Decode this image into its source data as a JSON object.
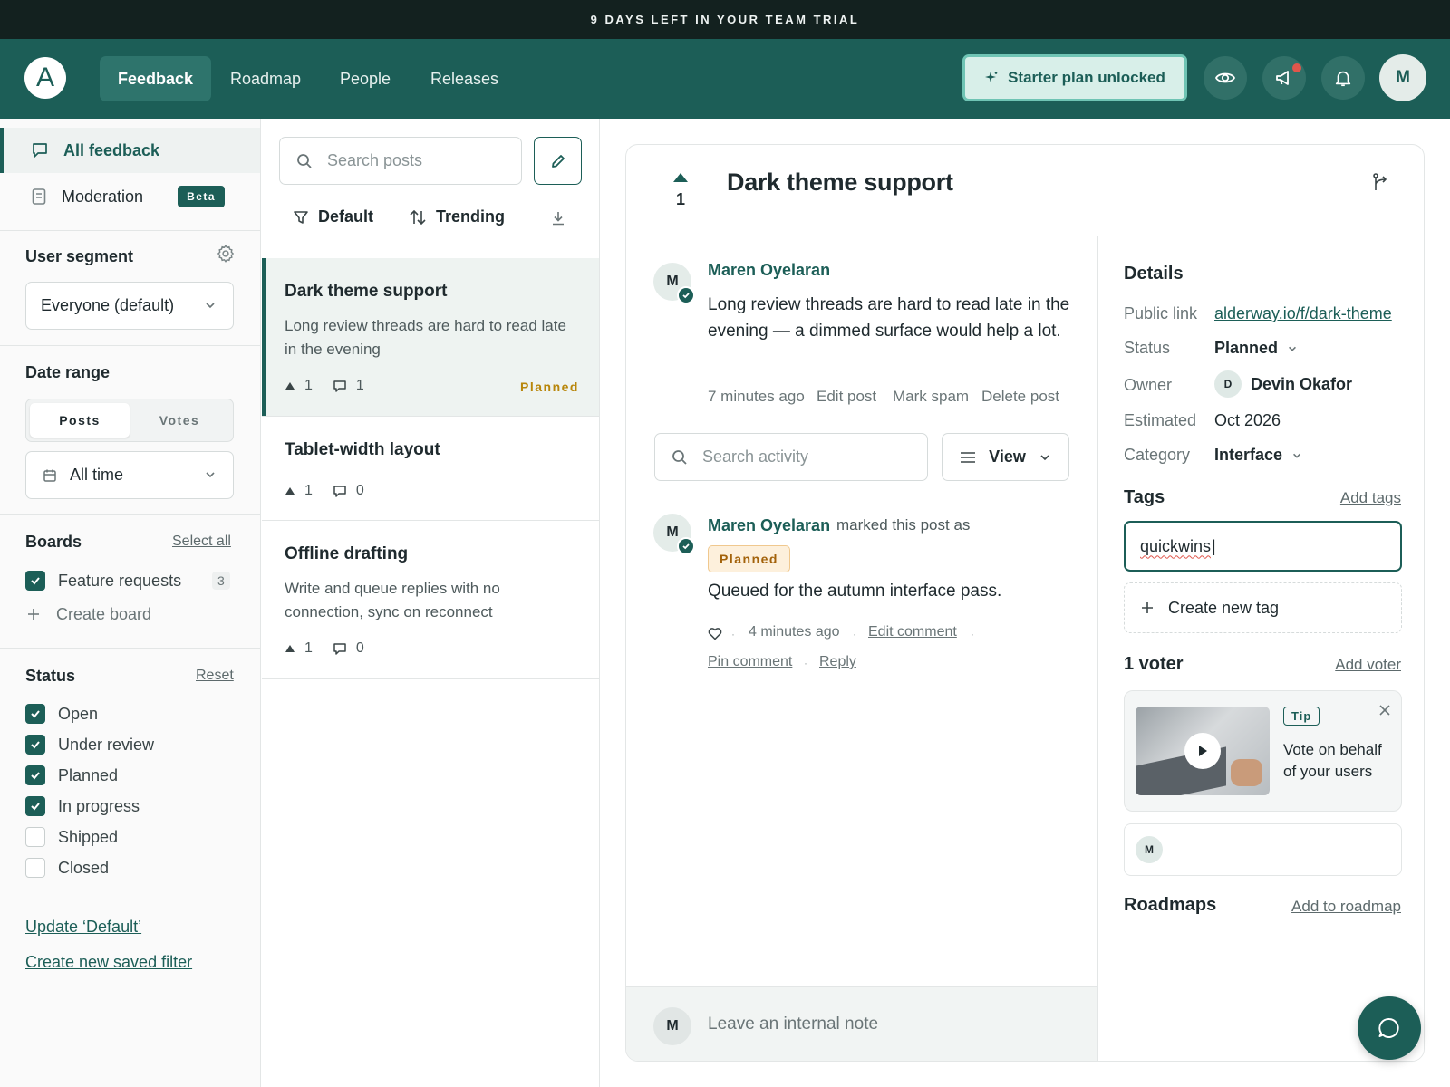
{
  "trial_banner": "9 DAYS LEFT IN YOUR TEAM TRIAL",
  "nav": {
    "logo": "A",
    "tabs": [
      "Feedback",
      "Roadmap",
      "People",
      "Releases"
    ],
    "active_tab": "Feedback",
    "starter_label": "Starter plan unlocked",
    "avatar_initial": "M"
  },
  "sidebar": {
    "items": [
      {
        "label": "All feedback",
        "icon": "chat-icon",
        "active": true
      },
      {
        "label": "Moderation",
        "icon": "document-icon",
        "badge": "Beta"
      }
    ],
    "user_segment": {
      "title": "User segment",
      "value": "Everyone (default)"
    },
    "date_range": {
      "title": "Date range",
      "segments": [
        "Posts",
        "Votes"
      ],
      "selected_segment": "Posts",
      "value": "All time"
    },
    "boards": {
      "title": "Boards",
      "select_all": "Select all",
      "items": [
        {
          "label": "Feature requests",
          "count": "3",
          "checked": true
        }
      ],
      "create": "Create board"
    },
    "status": {
      "title": "Status",
      "reset": "Reset",
      "items": [
        {
          "label": "Open",
          "checked": true
        },
        {
          "label": "Under review",
          "checked": true
        },
        {
          "label": "Planned",
          "checked": true
        },
        {
          "label": "In progress",
          "checked": true
        },
        {
          "label": "Shipped",
          "checked": false
        },
        {
          "label": "Closed",
          "checked": false
        }
      ]
    },
    "update_default": "Update ‘Default’",
    "create_saved_filter": "Create new saved filter"
  },
  "posts": {
    "search_placeholder": "Search posts",
    "sort_default": "Default",
    "sort_trending": "Trending",
    "items": [
      {
        "title": "Dark theme support",
        "desc": "Long review threads are hard to read late in the evening",
        "votes": "1",
        "comments": "1",
        "status": "Planned",
        "selected": true
      },
      {
        "title": "Tablet-width layout",
        "desc": "",
        "votes": "1",
        "comments": "0",
        "status": ""
      },
      {
        "title": "Offline drafting",
        "desc": "Write and queue replies with no connection, sync on reconnect",
        "votes": "1",
        "comments": "0",
        "status": ""
      }
    ]
  },
  "post": {
    "title": "Dark theme support",
    "votes": "1",
    "author": "Maren Oyelaran",
    "author_initial": "M",
    "body": "Long review threads are hard to read late in the evening — a dimmed surface would help a lot.",
    "time": "7 minutes ago",
    "actions": [
      "Edit post",
      "Mark spam",
      "Delete post"
    ],
    "activity_search_placeholder": "Search activity",
    "view_label": "View",
    "activity": {
      "author": "Maren Oyelaran",
      "action": "marked this post as",
      "status": "Planned",
      "comment": "Queued for the autumn interface pass.",
      "time": "4 minutes ago",
      "links": [
        "Edit comment",
        "Pin comment",
        "Reply"
      ]
    },
    "note_placeholder": "Leave an internal note"
  },
  "details": {
    "title": "Details",
    "public_link_label": "Public link",
    "public_link": "alderway.io/f/dark-theme",
    "status_label": "Status",
    "status": "Planned",
    "owner_label": "Owner",
    "owner_initial": "D",
    "owner": "Devin Okafor",
    "estimated_label": "Estimated",
    "estimated": "Oct 2026",
    "category_label": "Category",
    "category": "Interface",
    "tags_title": "Tags",
    "add_tags": "Add tags",
    "tag_input_value": "quickwins",
    "create_tag": "Create new tag",
    "voters_title": "1 voter",
    "add_voter": "Add voter",
    "tip_badge": "Tip",
    "tip_text": "Vote on behalf of your users",
    "voter_initial": "M",
    "roadmaps_title": "Roadmaps",
    "add_to_roadmap": "Add to roadmap"
  },
  "colors": {
    "brand": "#1c5e57",
    "trial_bar": "#13211f",
    "planned": "#b8860b"
  }
}
